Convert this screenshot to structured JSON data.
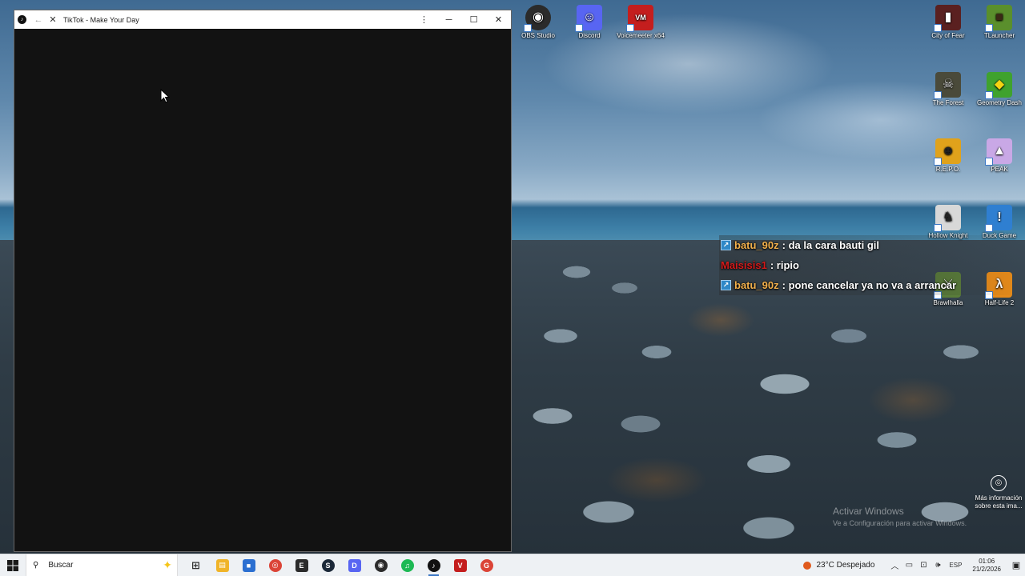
{
  "window": {
    "title": "TikTok - Make Your Day",
    "app_icon": "tiktok-icon",
    "controls": {
      "menu": "more-vert-icon",
      "minimize": "minimize-icon",
      "maximize": "maximize-icon",
      "close": "close-icon"
    }
  },
  "desktop": {
    "icons": [
      {
        "label": "OBS Studio",
        "color": "#2b2b2b",
        "glyph": "◉"
      },
      {
        "label": "Discord",
        "color": "#5865f2",
        "glyph": "☺"
      },
      {
        "label": "Voicemeeter x64",
        "color": "#c41e1e",
        "glyph": "VM"
      },
      {
        "label": "City of Fear",
        "color": "#5a2020",
        "glyph": "▮"
      },
      {
        "label": "TLauncher",
        "color": "#5a8f2c",
        "glyph": "■"
      },
      {
        "label": "The Forest",
        "color": "#4a4a3a",
        "glyph": "☠"
      },
      {
        "label": "Geometry Dash",
        "color": "#3fa22e",
        "glyph": "◆"
      },
      {
        "label": "R.E.P.O.",
        "color": "#e0a21b",
        "glyph": "☻"
      },
      {
        "label": "PEAK",
        "color": "#c9a8e6",
        "glyph": "▲"
      },
      {
        "label": "Hollow Knight",
        "color": "#d8d8d8",
        "glyph": "♞"
      },
      {
        "label": "Duck Game",
        "color": "#2f7fd1",
        "glyph": "!"
      },
      {
        "label": "Brawlhalla",
        "color": "#5a7d3a",
        "glyph": "⚔"
      },
      {
        "label": "Half-Life 2",
        "color": "#e58a1a",
        "glyph": "λ"
      }
    ],
    "chat": [
      {
        "user": "batu_90z",
        "message": ": da la cara bauti gil",
        "badge": true,
        "user_color": "#f2b04c"
      },
      {
        "user": "Maisisis1",
        "message": ": ripio",
        "badge": false,
        "user_color": "#d21a1a"
      },
      {
        "user": "batu_90z",
        "message": ": pone cancelar ya no va a arrancar",
        "badge": true,
        "user_color": "#f2b04c"
      }
    ],
    "activation": {
      "title": "Activar Windows",
      "subtitle": "Ve a Configuración para activar Windows."
    },
    "more_info": {
      "label": "Más información sobre esta ima..."
    }
  },
  "taskbar": {
    "search_placeholder": "Buscar",
    "weather": "23°C Despejado",
    "language": "ESP",
    "time": "01:06",
    "date": "21/2/2026",
    "apps": [
      {
        "name": "taskview-icon",
        "color": "#555",
        "glyph": "⊞"
      },
      {
        "name": "file-explorer-icon",
        "color": "#f0b429",
        "glyph": "▤"
      },
      {
        "name": "store-icon",
        "color": "#2b6fd1",
        "glyph": "■"
      },
      {
        "name": "chrome-icon",
        "color": "#db4437",
        "glyph": "◎"
      },
      {
        "name": "epic-games-icon",
        "color": "#2b2b2b",
        "glyph": "E"
      },
      {
        "name": "steam-icon",
        "color": "#1b2838",
        "glyph": "S"
      },
      {
        "name": "discord-icon",
        "color": "#5865f2",
        "glyph": "D"
      },
      {
        "name": "obs-icon",
        "color": "#2b2b2b",
        "glyph": "◉"
      },
      {
        "name": "spotify-icon",
        "color": "#1db954",
        "glyph": "♫"
      },
      {
        "name": "tiktok-icon",
        "color": "#111111",
        "glyph": "♪"
      },
      {
        "name": "voicemeeter-icon",
        "color": "#c41e1e",
        "glyph": "V"
      },
      {
        "name": "google-icon",
        "color": "#db4437",
        "glyph": "G"
      }
    ]
  }
}
